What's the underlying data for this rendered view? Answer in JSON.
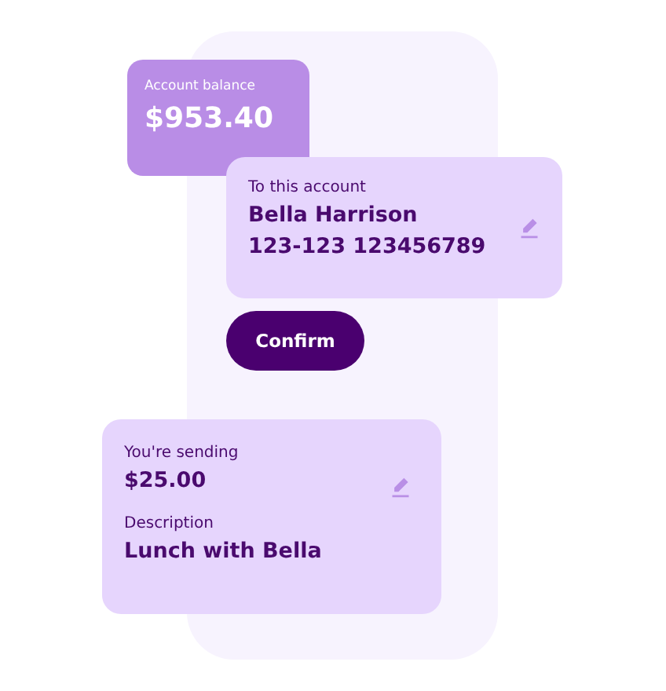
{
  "balance": {
    "label": "Account balance",
    "amount": "$953.40"
  },
  "recipient": {
    "label": "To this account",
    "name": "Bella Harrison",
    "account": "123-123 123456789"
  },
  "confirm_button": {
    "label": "Confirm"
  },
  "payment": {
    "amount_label": "You're sending",
    "amount": "$25.00",
    "description_label": "Description",
    "description": "Lunch with Bella"
  }
}
